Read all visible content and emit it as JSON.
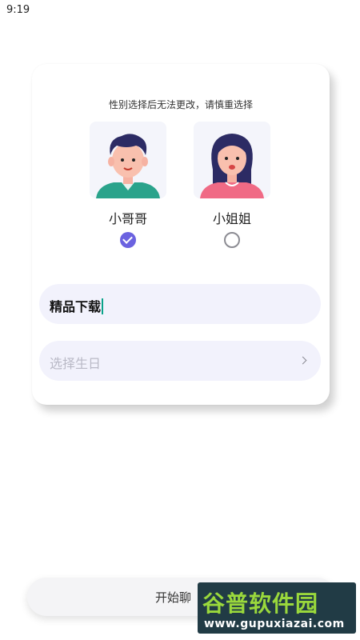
{
  "status_bar": {
    "time": "9:19"
  },
  "card": {
    "notice": "性别选择后无法更改，请慎重选择",
    "options": [
      {
        "label": "小哥哥",
        "selected": true
      },
      {
        "label": "小姐姐",
        "selected": false
      }
    ],
    "name_field": {
      "value": "精品下载"
    },
    "birthday_field": {
      "placeholder": "选择生日"
    }
  },
  "start_button": {
    "label": "开始聊"
  },
  "watermark": {
    "brand": "谷普软件园",
    "url": "www.gupuxiazai.com"
  },
  "colors": {
    "accent": "#6b62e0",
    "field_bg": "#f2f2fc",
    "watermark_bg": "#213b45",
    "watermark_green": "#9ad83c"
  }
}
